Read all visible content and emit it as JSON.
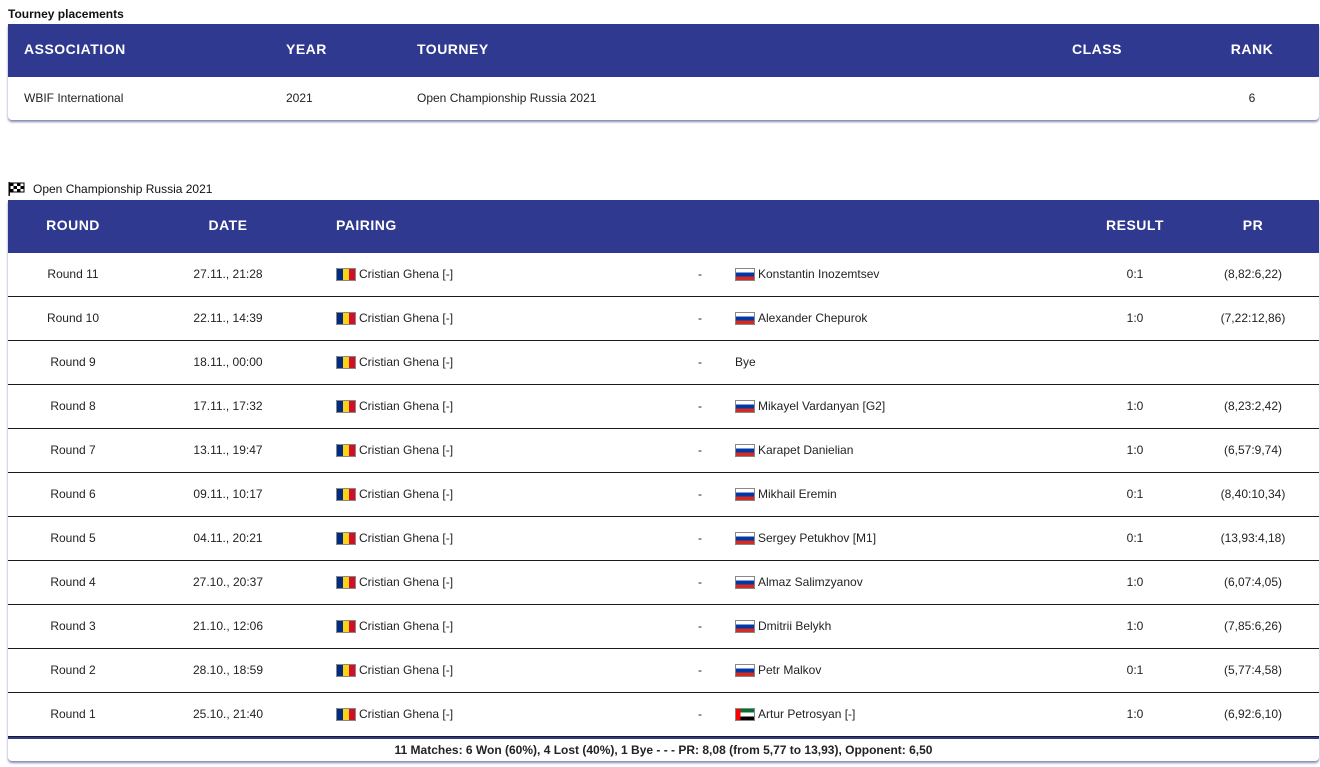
{
  "placements": {
    "title": "Tourney placements",
    "headers": {
      "association": "ASSOCIATION",
      "year": "YEAR",
      "tourney": "TOURNEY",
      "class": "CLASS",
      "rank": "RANK"
    },
    "row": {
      "association": "WBIF International",
      "year": "2021",
      "tourney": "Open Championship Russia 2021",
      "class": "",
      "rank": "6"
    }
  },
  "tourney": {
    "icon": "checkered-flag-icon",
    "title": "Open Championship Russia 2021",
    "headers": {
      "round": "ROUND",
      "date": "DATE",
      "pairing": "PAIRING",
      "result": "RESULT",
      "pr": "PR"
    },
    "separator": "-",
    "rows": [
      {
        "round": "Round 11",
        "date": "27.11., 21:28",
        "player": "Cristian Ghena [-]",
        "player_flag": "ro",
        "opponent": "Konstantin Inozemtsev",
        "opponent_flag": "ru",
        "result": "0:1",
        "pr": "(8,82:6,22)"
      },
      {
        "round": "Round 10",
        "date": "22.11., 14:39",
        "player": "Cristian Ghena [-]",
        "player_flag": "ro",
        "opponent": "Alexander Chepurok",
        "opponent_flag": "ru",
        "result": "1:0",
        "pr": "(7,22:12,86)"
      },
      {
        "round": "Round 9",
        "date": "18.11., 00:00",
        "player": "Cristian Ghena [-]",
        "player_flag": "ro",
        "opponent": "Bye",
        "opponent_flag": "",
        "result": "",
        "pr": ""
      },
      {
        "round": "Round 8",
        "date": "17.11., 17:32",
        "player": "Cristian Ghena [-]",
        "player_flag": "ro",
        "opponent": "Mikayel Vardanyan [G2]",
        "opponent_flag": "ru",
        "result": "1:0",
        "pr": "(8,23:2,42)"
      },
      {
        "round": "Round 7",
        "date": "13.11., 19:47",
        "player": "Cristian Ghena [-]",
        "player_flag": "ro",
        "opponent": "Karapet Danielian",
        "opponent_flag": "ru",
        "result": "1:0",
        "pr": "(6,57:9,74)"
      },
      {
        "round": "Round 6",
        "date": "09.11., 10:17",
        "player": "Cristian Ghena [-]",
        "player_flag": "ro",
        "opponent": "Mikhail Eremin",
        "opponent_flag": "ru",
        "result": "0:1",
        "pr": "(8,40:10,34)"
      },
      {
        "round": "Round 5",
        "date": "04.11., 20:21",
        "player": "Cristian Ghena [-]",
        "player_flag": "ro",
        "opponent": "Sergey Petukhov [M1]",
        "opponent_flag": "ru",
        "result": "0:1",
        "pr": "(13,93:4,18)"
      },
      {
        "round": "Round 4",
        "date": "27.10., 20:37",
        "player": "Cristian Ghena [-]",
        "player_flag": "ro",
        "opponent": "Almaz Salimzyanov",
        "opponent_flag": "ru",
        "result": "1:0",
        "pr": "(6,07:4,05)"
      },
      {
        "round": "Round 3",
        "date": "21.10., 12:06",
        "player": "Cristian Ghena [-]",
        "player_flag": "ro",
        "opponent": "Dmitrii Belykh",
        "opponent_flag": "ru",
        "result": "1:0",
        "pr": "(7,85:6,26)"
      },
      {
        "round": "Round 2",
        "date": "28.10., 18:59",
        "player": "Cristian Ghena [-]",
        "player_flag": "ro",
        "opponent": "Petr Malkov",
        "opponent_flag": "ru",
        "result": "0:1",
        "pr": "(5,77:4,58)"
      },
      {
        "round": "Round 1",
        "date": "25.10., 21:40",
        "player": "Cristian Ghena [-]",
        "player_flag": "ro",
        "opponent": "Artur Petrosyan [-]",
        "opponent_flag": "ae",
        "result": "1:0",
        "pr": "(6,92:6,10)"
      }
    ],
    "summary": "11 Matches: 6 Won (60%), 4 Lost (40%), 1 Bye - - - PR: 8,08 (from 5,77 to 13,93), Opponent: 6,50"
  },
  "colors": {
    "header_bg": "#2f3990",
    "header_text": "#ffffff"
  }
}
